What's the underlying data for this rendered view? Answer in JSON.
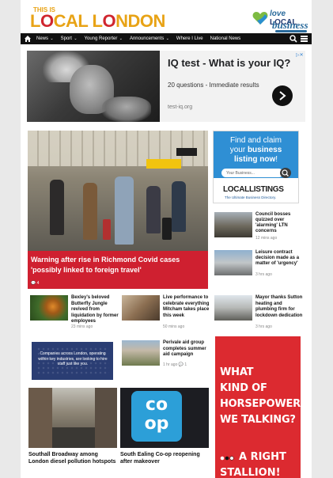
{
  "header": {
    "logo_small": "THIS IS",
    "logo_main_a": "L",
    "logo_main_o": "O",
    "logo_main_b": "CAL L",
    "logo_main_o2": "O",
    "logo_main_c": "NDON",
    "partner_line1_a": "love",
    "partner_line1_b": "LOCAL",
    "partner_line2": "business"
  },
  "nav": {
    "items": [
      {
        "label": "News",
        "dropdown": true
      },
      {
        "label": "Sport",
        "dropdown": true
      },
      {
        "label": "Young Reporter",
        "dropdown": true
      },
      {
        "label": "Announcements",
        "dropdown": true
      },
      {
        "label": "Where I Live",
        "dropdown": false
      },
      {
        "label": "National News",
        "dropdown": false
      }
    ],
    "icons": [
      "home-icon",
      "search-icon",
      "menu-icon"
    ]
  },
  "ad_top": {
    "badge": "▷✕",
    "title": "IQ test - What is your IQ?",
    "description": "20 questions - Immediate results",
    "url": "test-iq.org"
  },
  "hero": {
    "title": "Warning after rise in Richmond Covid cases 'possibly linked to foreign travel'",
    "comments": "💬 4"
  },
  "listing_ad": {
    "line1": "Find and claim",
    "line2": "your ",
    "line2_bold": "business",
    "line3_bold": "listing now",
    "line3_end": "!",
    "input_placeholder": "Your Business...",
    "logo": "LOCALLISTINGS",
    "sub": "The Ultimate Business Directory."
  },
  "side_stories": [
    {
      "title": "Council bosses quizzed over 'alarming' LTN concerns",
      "time": "12 mins ago"
    },
    {
      "title": "Leisure contract decision made as a matter of 'urgency'",
      "time": "3 hrs ago"
    }
  ],
  "stories": [
    {
      "title": "Bexley's beloved Butterfly Jungle revived from liquidation by former employees",
      "time": "23 mins ago"
    },
    {
      "title": "Live performance to celebrate everything Mitcham takes place this week",
      "time": "50 mins ago"
    },
    {
      "title": "Mayor thanks Sutton heating and plumbing firm for lockdown dedication",
      "time": "3 hrs ago"
    },
    {
      "title": "Perivale aid group completes summer aid campaign",
      "time": "1 hr ago  💬 1"
    }
  ],
  "ad_small": {
    "text": "Companies across London, operating within key industries, are looking to hire staff just like you."
  },
  "big_cards": [
    {
      "title": "Southall Broadway among London diesel pollution hotspots"
    },
    {
      "title": "South Ealing Co-op reopening after makeover"
    }
  ],
  "coop_logo": "co op",
  "red_ad": {
    "line1": "WHAT",
    "line2": "KIND OF",
    "line3": "HORSEPOWER",
    "line4": "WE TALKING?",
    "line5": "A RIGHT",
    "line6": "STALLION!"
  },
  "colors": {
    "brand_orange": "#e8a316",
    "brand_red": "#cf2030",
    "nav_bg": "#111111",
    "listing_blue": "#2f8fd4",
    "ad_red": "#dc2a30"
  }
}
